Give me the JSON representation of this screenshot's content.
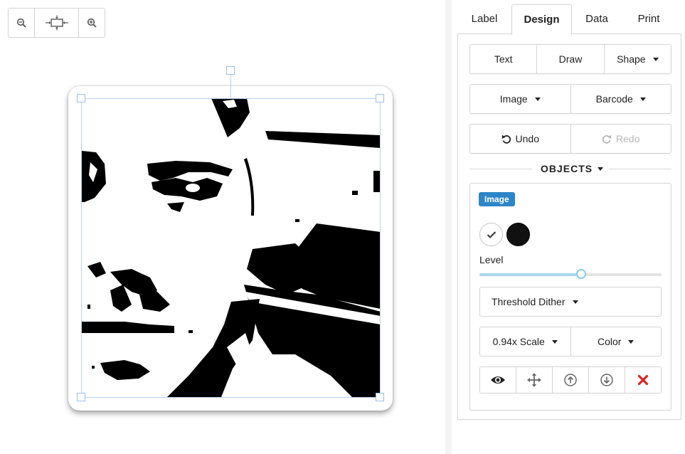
{
  "tabs": [
    {
      "label": "Label"
    },
    {
      "label": "Design",
      "active": true
    },
    {
      "label": "Data"
    },
    {
      "label": "Print"
    }
  ],
  "design": {
    "row1": {
      "text": "Text",
      "draw": "Draw",
      "shape": "Shape"
    },
    "row2": {
      "image": "Image",
      "barcode": "Barcode"
    },
    "row3": {
      "undo": "Undo",
      "redo": "Redo"
    }
  },
  "objects": {
    "title": "OBJECTS",
    "selected": {
      "type_badge": "Image",
      "level_label": "Level",
      "level_value": 0.56,
      "dither": "Threshold Dither",
      "scale": "0.94x Scale",
      "color": "Color"
    }
  },
  "zoom_toolbar": {
    "icons": [
      "zoom-out-icon",
      "fit-to-screen-icon",
      "zoom-in-icon"
    ]
  },
  "canvas": {
    "label_shape": "rounded-square",
    "image_style": "black-and-white threshold portrait photo"
  },
  "colors": {
    "accent": "#2d85c9",
    "slider": "#a9d6f2",
    "selection": "#b9d3f0",
    "delete": "#e02424"
  }
}
